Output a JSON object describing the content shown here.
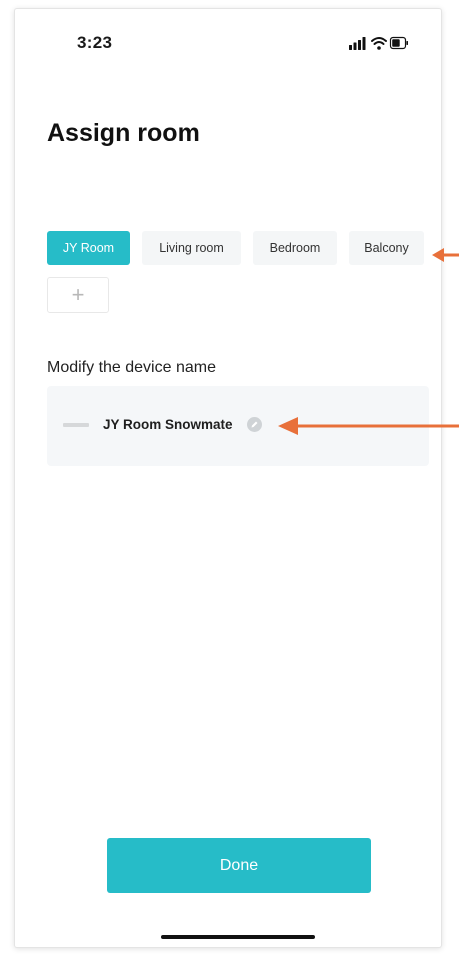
{
  "status_bar": {
    "time": "3:23"
  },
  "page": {
    "title": "Assign room"
  },
  "rooms": [
    {
      "label": "JY Room",
      "selected": true
    },
    {
      "label": "Living room",
      "selected": false
    },
    {
      "label": "Bedroom",
      "selected": false
    },
    {
      "label": "Balcony",
      "selected": false
    }
  ],
  "add_room": {
    "label": "+"
  },
  "device_section": {
    "label": "Modify the device name",
    "device_name": "JY Room Snowmate"
  },
  "done": {
    "label": "Done"
  },
  "colors": {
    "accent": "#26bcc8",
    "annotation_arrow": "#e8703a"
  },
  "icons": [
    "signal-bars-icon",
    "wifi-icon",
    "battery-icon",
    "device-icon",
    "edit-pencil-icon",
    "plus-icon"
  ]
}
